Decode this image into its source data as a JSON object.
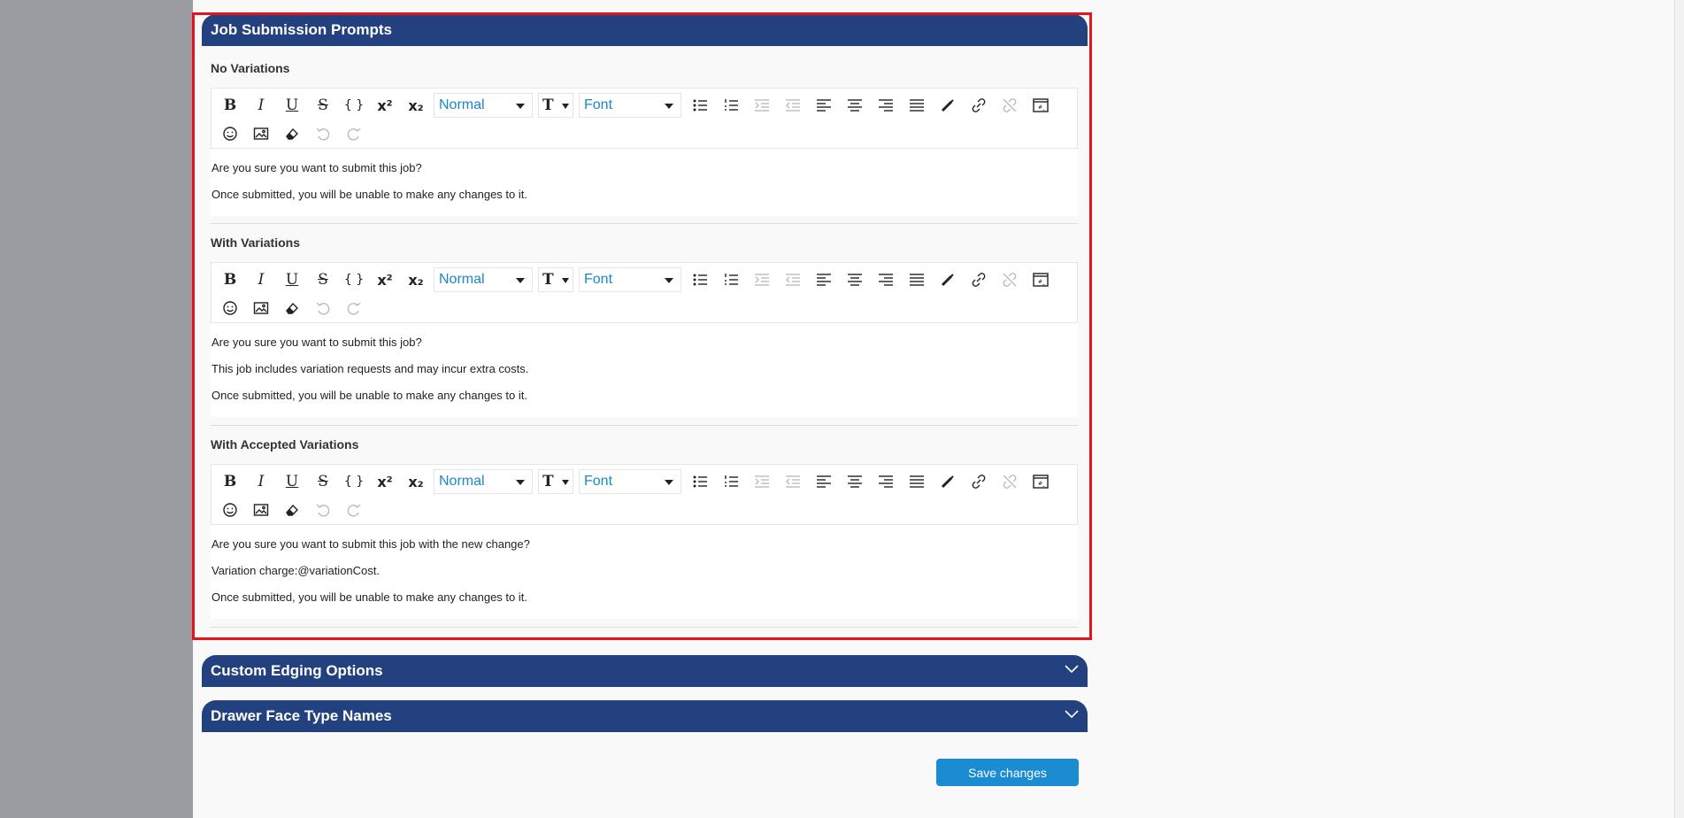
{
  "panels": {
    "job_submission": {
      "title": "Job Submission Prompts",
      "sections": [
        {
          "label": "No Variations",
          "lines": [
            "Are you sure you want to submit this job?",
            "Once submitted, you will be unable to make any changes to it."
          ]
        },
        {
          "label": "With Variations",
          "lines": [
            "Are you sure you want to submit this job?",
            "This job includes variation requests and may incur extra costs.",
            "Once submitted, you will be unable to make any changes to it."
          ]
        },
        {
          "label": "With Accepted Variations",
          "lines": [
            "Are you sure you want to submit this job with the new change?",
            "Variation charge:@variationCost.",
            "Once submitted, you will be unable to make any changes to it."
          ]
        }
      ]
    },
    "custom_edging": {
      "title": "Custom Edging Options"
    },
    "drawer_face": {
      "title": "Drawer Face Type Names"
    }
  },
  "toolbar": {
    "format_value": "Normal",
    "font_value": "Font",
    "size_glyph": "T",
    "bold_glyph": "B",
    "italic_glyph": "I",
    "underline_glyph": "U",
    "strike_glyph": "S",
    "code_glyph": "{ }",
    "superscript_glyph": "x²",
    "subscript_glyph": "x₂"
  },
  "actions": {
    "save_label": "Save changes"
  },
  "colors": {
    "header_bg": "#23417e",
    "accent": "#1b8bd2",
    "highlight": "#e3141d"
  },
  "icons": [
    "bold-icon",
    "italic-icon",
    "underline-icon",
    "strikethrough-icon",
    "code-icon",
    "superscript-icon",
    "subscript-icon",
    "bullet-list-icon",
    "numbered-list-icon",
    "indent-icon",
    "outdent-icon",
    "align-left-icon",
    "align-center-icon",
    "align-right-icon",
    "align-justify-icon",
    "color-picker-icon",
    "link-icon",
    "unlink-icon",
    "embed-icon",
    "emoji-icon",
    "image-icon",
    "eraser-icon",
    "undo-icon",
    "redo-icon",
    "chevron-down-icon"
  ]
}
